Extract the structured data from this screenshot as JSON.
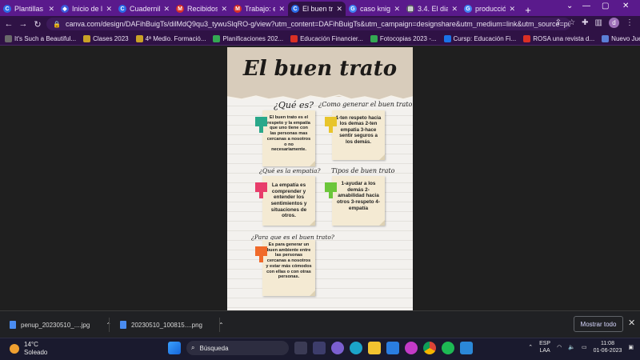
{
  "browser": {
    "tabs": [
      {
        "title": "Plantillas",
        "icon": "canva-icon",
        "color": "#2b6de8"
      },
      {
        "title": "Inicio de l...",
        "icon": "shield-icon",
        "color": "#3b5bdb"
      },
      {
        "title": "Cuadernill...",
        "icon": "canva-icon",
        "color": "#2b6de8"
      },
      {
        "title": "Recibidos",
        "icon": "gmail-icon",
        "color": "#d93025"
      },
      {
        "title": "Trabajo: el",
        "icon": "gmail-icon",
        "color": "#d93025"
      },
      {
        "title": "El buen tra",
        "icon": "canva-icon",
        "color": "#2b6de8",
        "active": true
      },
      {
        "title": "caso knigh",
        "icon": "google-icon",
        "color": "#4285f4"
      },
      {
        "title": "3.4. El diar",
        "icon": "document-icon",
        "color": "#5f6368"
      },
      {
        "title": "producció",
        "icon": "google-icon",
        "color": "#4285f4"
      }
    ],
    "new_tab": "+",
    "url": "canva.com/design/DAFihBuigTs/dilMdQ9qu3_tywuSlqRO-g/view?utm_content=DAFihBuigTs&utm_campaign=designshare&utm_medium=link&utm_source=publi...",
    "profile_initial": "d",
    "bookmarks": [
      {
        "label": "It's Such a Beautiful...",
        "color": "#6a6a6a"
      },
      {
        "label": "Clases 2023",
        "color": "#c9a227"
      },
      {
        "label": "4ª Medio. Formació...",
        "color": "#c9a227"
      },
      {
        "label": "Planificaciones 202...",
        "color": "#34a853"
      },
      {
        "label": "Educación Financier...",
        "color": "#d93025"
      },
      {
        "label": "Fotocopias 2023 -...",
        "color": "#34a853"
      },
      {
        "label": "Cursp: Educación Fi...",
        "color": "#1a73e8"
      },
      {
        "label": "ROSA una revista d...",
        "color": "#d93025"
      },
      {
        "label": "Nuevo Juego / Jue...",
        "color": "#5b7fd6"
      }
    ]
  },
  "poster": {
    "title": "El buen trato",
    "sections": [
      {
        "heading": "¿Qué es?",
        "flag": "#2aa88a",
        "text": "El buen trato es el respeto y la empatía que uno tiene con las personas mas cercanas a nosotros o no necesariamente."
      },
      {
        "heading": "¿Como generar el buen trato?",
        "flag": "#e8c52b",
        "text": "1-ten respeto hacia los demas 2-ten empatia 3-hace sentir seguros a los demás."
      },
      {
        "heading": "¿Qué es la empatia?",
        "flag": "#e83d6a",
        "text": "La empatía es comprender y entender los sentimientos y situaciones de otros."
      },
      {
        "heading": "Tipos de buen trato",
        "flag": "#6cc63a",
        "text": "1-ayudar a los demás 2-amabilidad hacia otros 3-respeto 4-empatía"
      },
      {
        "heading": "¿Para que es el buen trato?",
        "flag": "#f06a2a",
        "text": "Es para generar un buen ambiente entre las personas cercanas a nosotros y estar más cómodos con ellas o con otras personas."
      }
    ]
  },
  "downloads": {
    "items": [
      {
        "name": "penup_20230510_....jpg"
      },
      {
        "name": "20230510_100815....png"
      }
    ],
    "show_all": "Mostrar todo"
  },
  "taskbar": {
    "weather_temp": "14°C",
    "weather_desc": "Soleado",
    "search_label": "Búsqueda",
    "lang_line1": "ESP",
    "lang_line2": "LAA",
    "time": "11:08",
    "date": "01-06-2023"
  }
}
